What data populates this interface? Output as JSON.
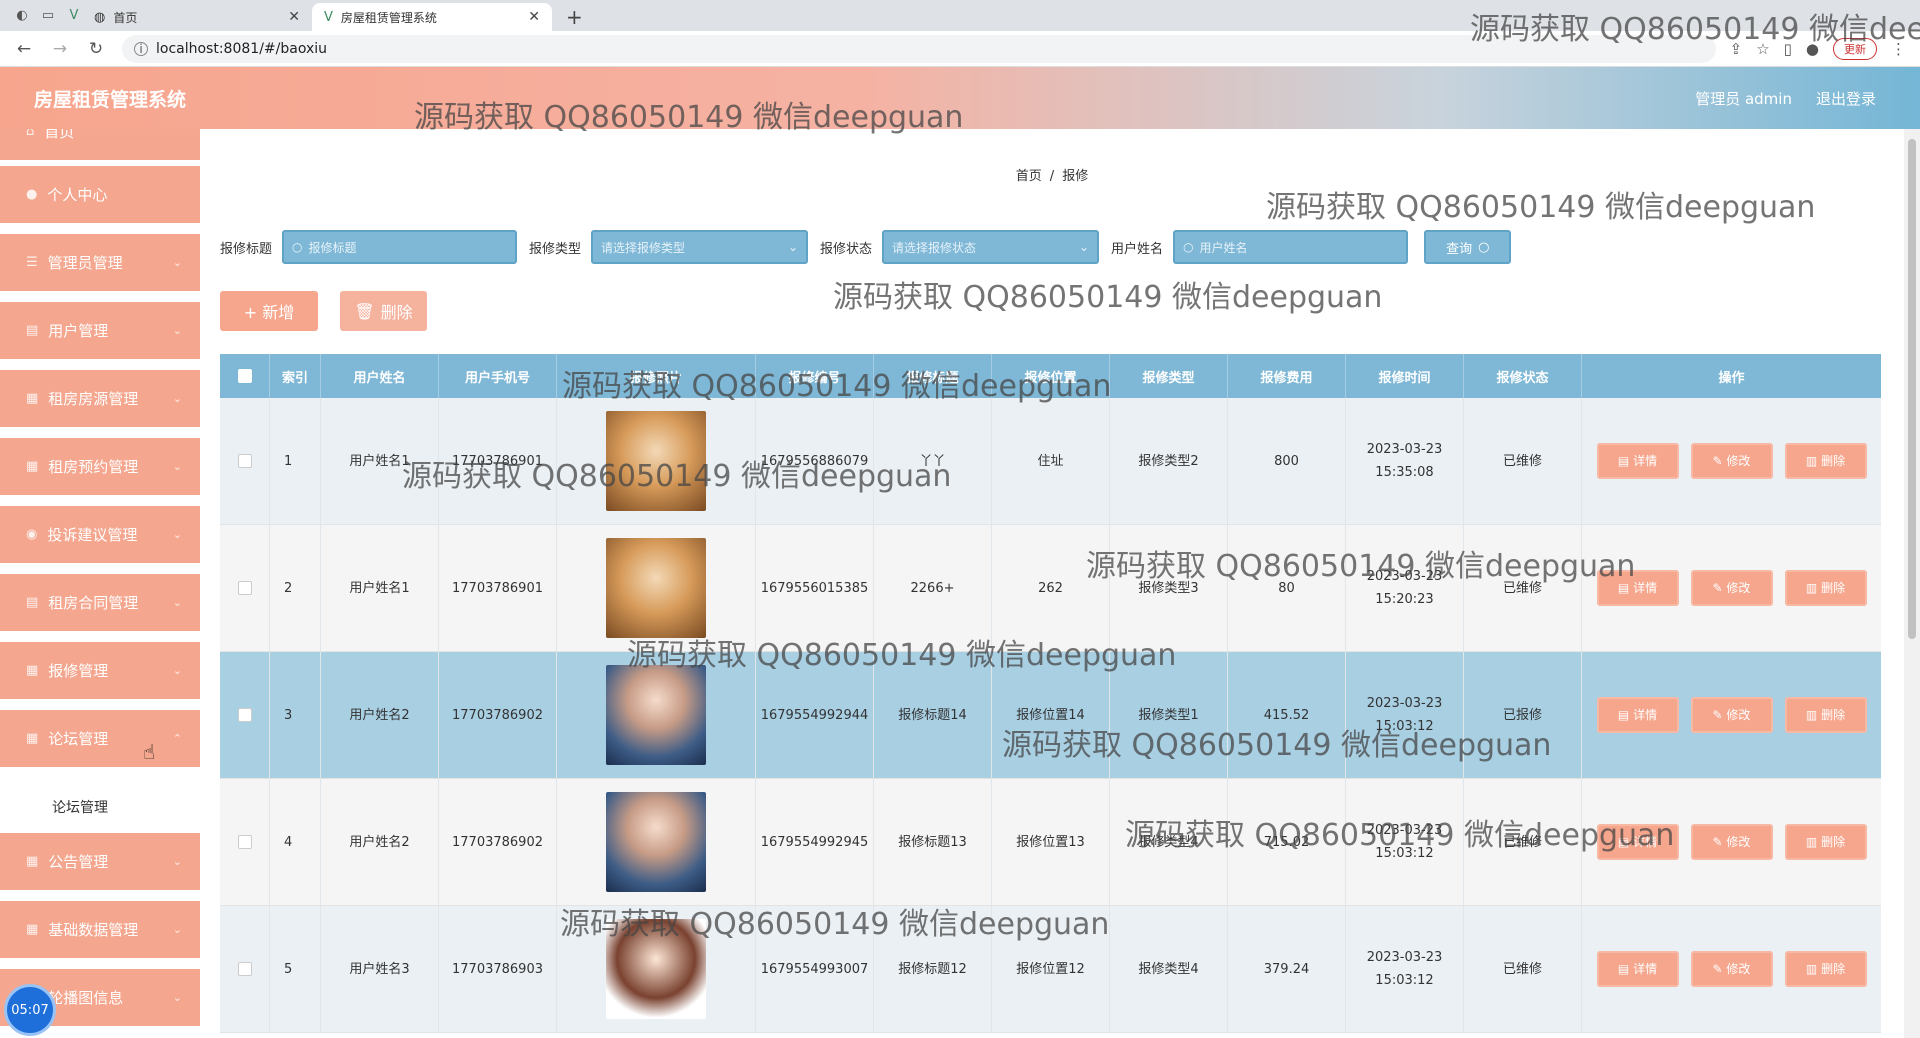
{
  "browser": {
    "tabs": [
      {
        "label": "首页",
        "active": false
      },
      {
        "label": "房屋租赁管理系统",
        "active": true
      }
    ],
    "url": "localhost:8081/#/baoxiu",
    "update_label": "更新"
  },
  "header": {
    "title": "房屋租赁管理系统",
    "user": "管理员 admin",
    "logout": "退出登录"
  },
  "sidebar": {
    "items": [
      {
        "label": "首页",
        "icon": "home-icon"
      },
      {
        "label": "个人中心",
        "icon": "user-icon"
      },
      {
        "label": "管理员管理",
        "icon": "admin-icon"
      },
      {
        "label": "用户管理",
        "icon": "users-icon"
      },
      {
        "label": "租房房源管理",
        "icon": "house-icon"
      },
      {
        "label": "租房预约管理",
        "icon": "calendar-icon"
      },
      {
        "label": "投诉建议管理",
        "icon": "complaint-icon"
      },
      {
        "label": "租房合同管理",
        "icon": "contract-icon"
      },
      {
        "label": "报修管理",
        "icon": "repair-icon"
      },
      {
        "label": "论坛管理",
        "icon": "forum-icon"
      },
      {
        "label": "公告管理",
        "icon": "notice-icon"
      },
      {
        "label": "基础数据管理",
        "icon": "data-icon"
      },
      {
        "label": "轮播图信息",
        "icon": "carousel-icon"
      }
    ],
    "submenu": {
      "label": "论坛管理"
    },
    "clock": "05:07"
  },
  "breadcrumb": {
    "home": "首页",
    "current": "报修"
  },
  "search": {
    "title_label": "报修标题",
    "title_placeholder": "报修标题",
    "type_label": "报修类型",
    "type_placeholder": "请选择报修类型",
    "status_label": "报修状态",
    "status_placeholder": "请选择报修状态",
    "username_label": "用户姓名",
    "username_placeholder": "用户姓名",
    "query_label": "查询"
  },
  "actions": {
    "add": "+ 新增",
    "delete": "删除"
  },
  "table": {
    "headers": [
      "索引",
      "用户姓名",
      "用户手机号",
      "报修照片",
      "报修编号",
      "报修标题",
      "报修位置",
      "报修类型",
      "报修费用",
      "报修时间",
      "报修状态",
      "操作"
    ],
    "rows": [
      {
        "index": "1",
        "name": "用户姓名1",
        "phone": "17703786901",
        "photo": "cat",
        "code": "1679556886079",
        "title": "丫丫",
        "location": "住址",
        "type": "报修类型2",
        "fee": "800",
        "time": "2023-03-23 15:35:08",
        "status": "已维修"
      },
      {
        "index": "2",
        "name": "用户姓名1",
        "phone": "17703786901",
        "photo": "cat",
        "code": "1679556015385",
        "title": "2266+",
        "location": "262",
        "type": "报修类型3",
        "fee": "80",
        "time": "2023-03-23 15:20:23",
        "status": "已维修"
      },
      {
        "index": "3",
        "name": "用户姓名2",
        "phone": "17703786902",
        "photo": "boy",
        "code": "1679554992944",
        "title": "报修标题14",
        "location": "报修位置14",
        "type": "报修类型1",
        "fee": "415.52",
        "time": "2023-03-23 15:03:12",
        "status": "已报修"
      },
      {
        "index": "4",
        "name": "用户姓名2",
        "phone": "17703786902",
        "photo": "boy",
        "code": "1679554992945",
        "title": "报修标题13",
        "location": "报修位置13",
        "type": "报修类型4",
        "fee": "715.02",
        "time": "2023-03-23 15:03:12",
        "status": "已维修"
      },
      {
        "index": "5",
        "name": "用户姓名3",
        "phone": "17703786903",
        "photo": "girl",
        "code": "1679554993007",
        "title": "报修标题12",
        "location": "报修位置12",
        "type": "报修类型4",
        "fee": "379.24",
        "time": "2023-03-23 15:03:12",
        "status": "已维修"
      }
    ],
    "op_detail": "详情",
    "op_edit": "修改",
    "op_delete": "删除"
  },
  "watermark": "源码获取 QQ86050149 微信deepguan",
  "colors": {
    "accent": "#f5a68d",
    "table_header": "#7fb8d6",
    "highlight_row": "#a9cfe3"
  }
}
